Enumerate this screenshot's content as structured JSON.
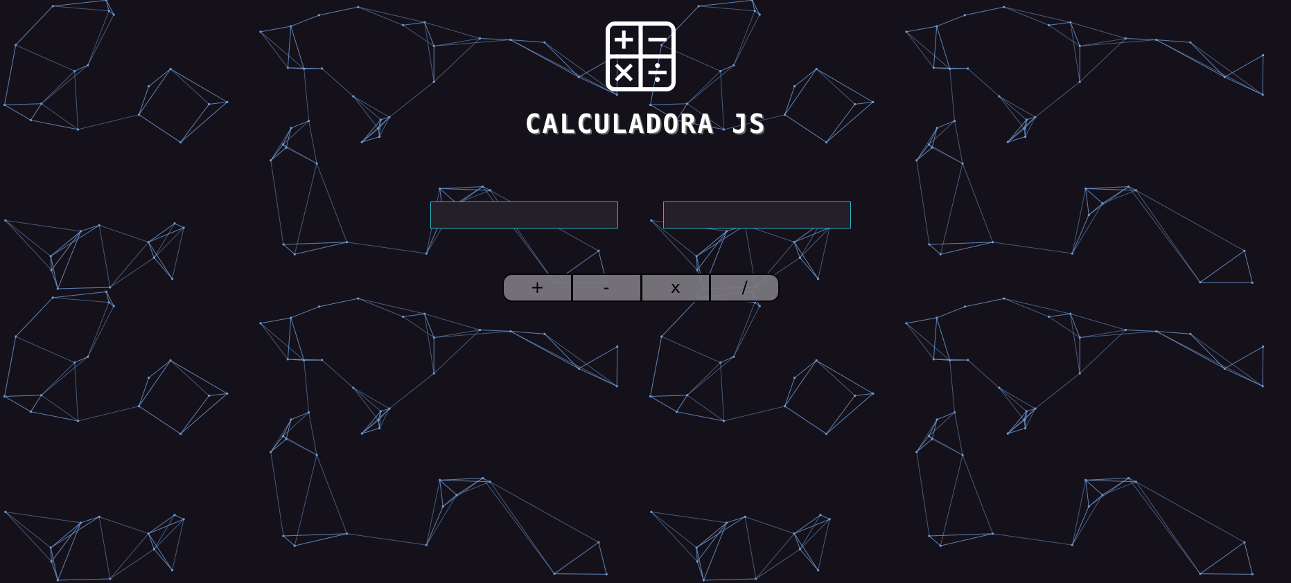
{
  "app": {
    "title": "CALCULADORA JS",
    "logo_icon": "calculator-operators-icon"
  },
  "inputs": {
    "first": {
      "value": "",
      "placeholder": ""
    },
    "second": {
      "value": "",
      "placeholder": ""
    }
  },
  "operations": [
    {
      "label": "+"
    },
    {
      "label": "-"
    },
    {
      "label": "x"
    },
    {
      "label": "/"
    }
  ],
  "colors": {
    "background": "#15111a",
    "network_lines": "#6f9bd1",
    "input_border": "#27b7c2",
    "button_fill": "#7d7880",
    "title_text": "#ffffff"
  }
}
